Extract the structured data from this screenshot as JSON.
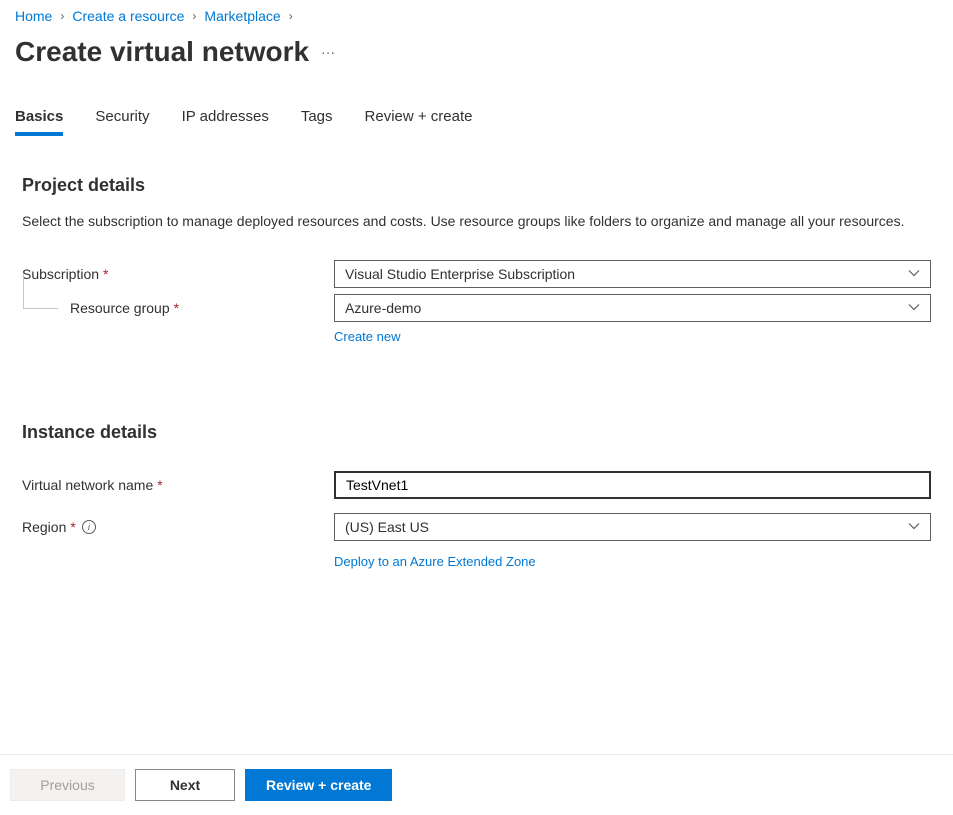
{
  "breadcrumb": {
    "items": [
      "Home",
      "Create a resource",
      "Marketplace"
    ]
  },
  "header": {
    "title": "Create virtual network"
  },
  "tabs": [
    {
      "label": "Basics",
      "active": true
    },
    {
      "label": "Security"
    },
    {
      "label": "IP addresses"
    },
    {
      "label": "Tags"
    },
    {
      "label": "Review + create"
    }
  ],
  "project": {
    "title": "Project details",
    "desc": "Select the subscription to manage deployed resources and costs. Use resource groups like folders to organize and manage all your resources.",
    "subscription_label": "Subscription",
    "subscription_value": "Visual Studio Enterprise Subscription",
    "resource_group_label": "Resource group",
    "resource_group_value": "Azure-demo",
    "create_new": "Create new"
  },
  "instance": {
    "title": "Instance details",
    "vnet_name_label": "Virtual network name",
    "vnet_name_value": "TestVnet1",
    "region_label": "Region",
    "region_value": "(US) East US",
    "deploy_link": "Deploy to an Azure Extended Zone"
  },
  "footer": {
    "previous": "Previous",
    "next": "Next",
    "review": "Review + create"
  }
}
